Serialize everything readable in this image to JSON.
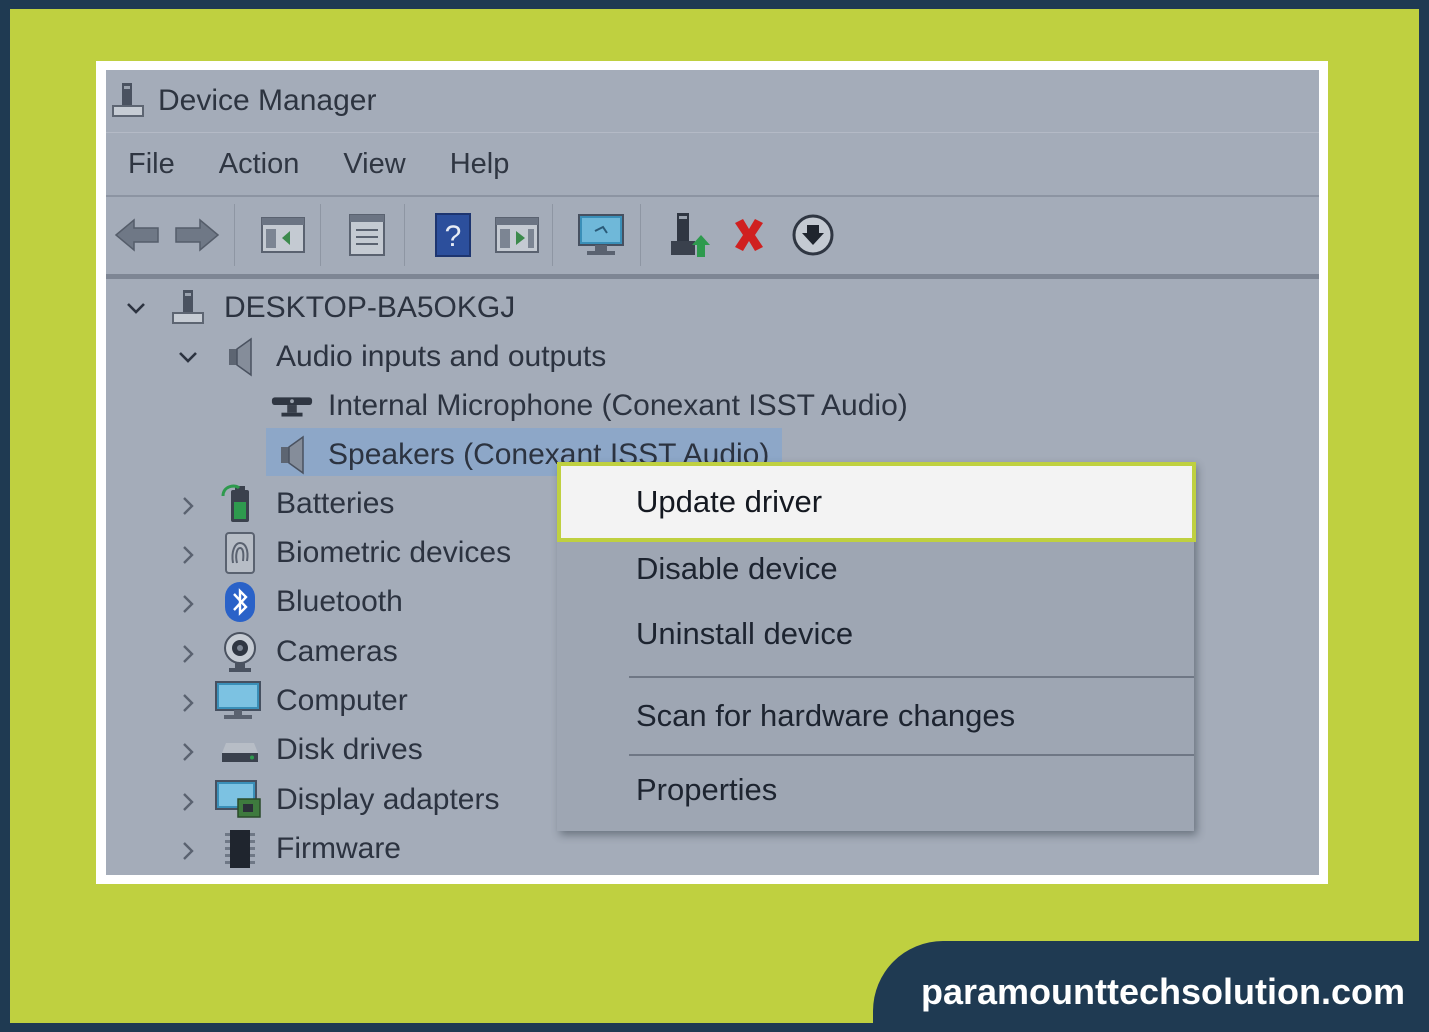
{
  "window": {
    "title": "Device Manager"
  },
  "menu": [
    "File",
    "Action",
    "View",
    "Help"
  ],
  "toolbar": {
    "icons": [
      "back-arrow-icon",
      "forward-arrow-icon",
      "show-hide-console-tree-icon",
      "properties-icon",
      "help-icon",
      "run-icon",
      "scan-monitor-icon",
      "update-driver-icon",
      "uninstall-x-icon",
      "download-icon"
    ]
  },
  "tree": {
    "root": "DESKTOP-BA5OKGJ",
    "audio_category": "Audio inputs and outputs",
    "audio_children": [
      "Internal Microphone (Conexant ISST Audio)",
      "Speakers (Conexant ISST Audio)"
    ],
    "categories": [
      "Batteries",
      "Biometric devices",
      "Bluetooth",
      "Cameras",
      "Computer",
      "Disk drives",
      "Display adapters",
      "Firmware"
    ]
  },
  "context_menu": {
    "items": [
      "Update driver",
      "Disable device",
      "Uninstall device",
      "Scan for hardware changes",
      "Properties"
    ],
    "highlighted": "Update driver"
  },
  "brand": {
    "text": "paramounttechsolution.com"
  },
  "colors": {
    "frame": "#1f3a52",
    "accent": "#bfd040",
    "window_bg": "#a4acb9",
    "selection": "#8da7c8"
  }
}
